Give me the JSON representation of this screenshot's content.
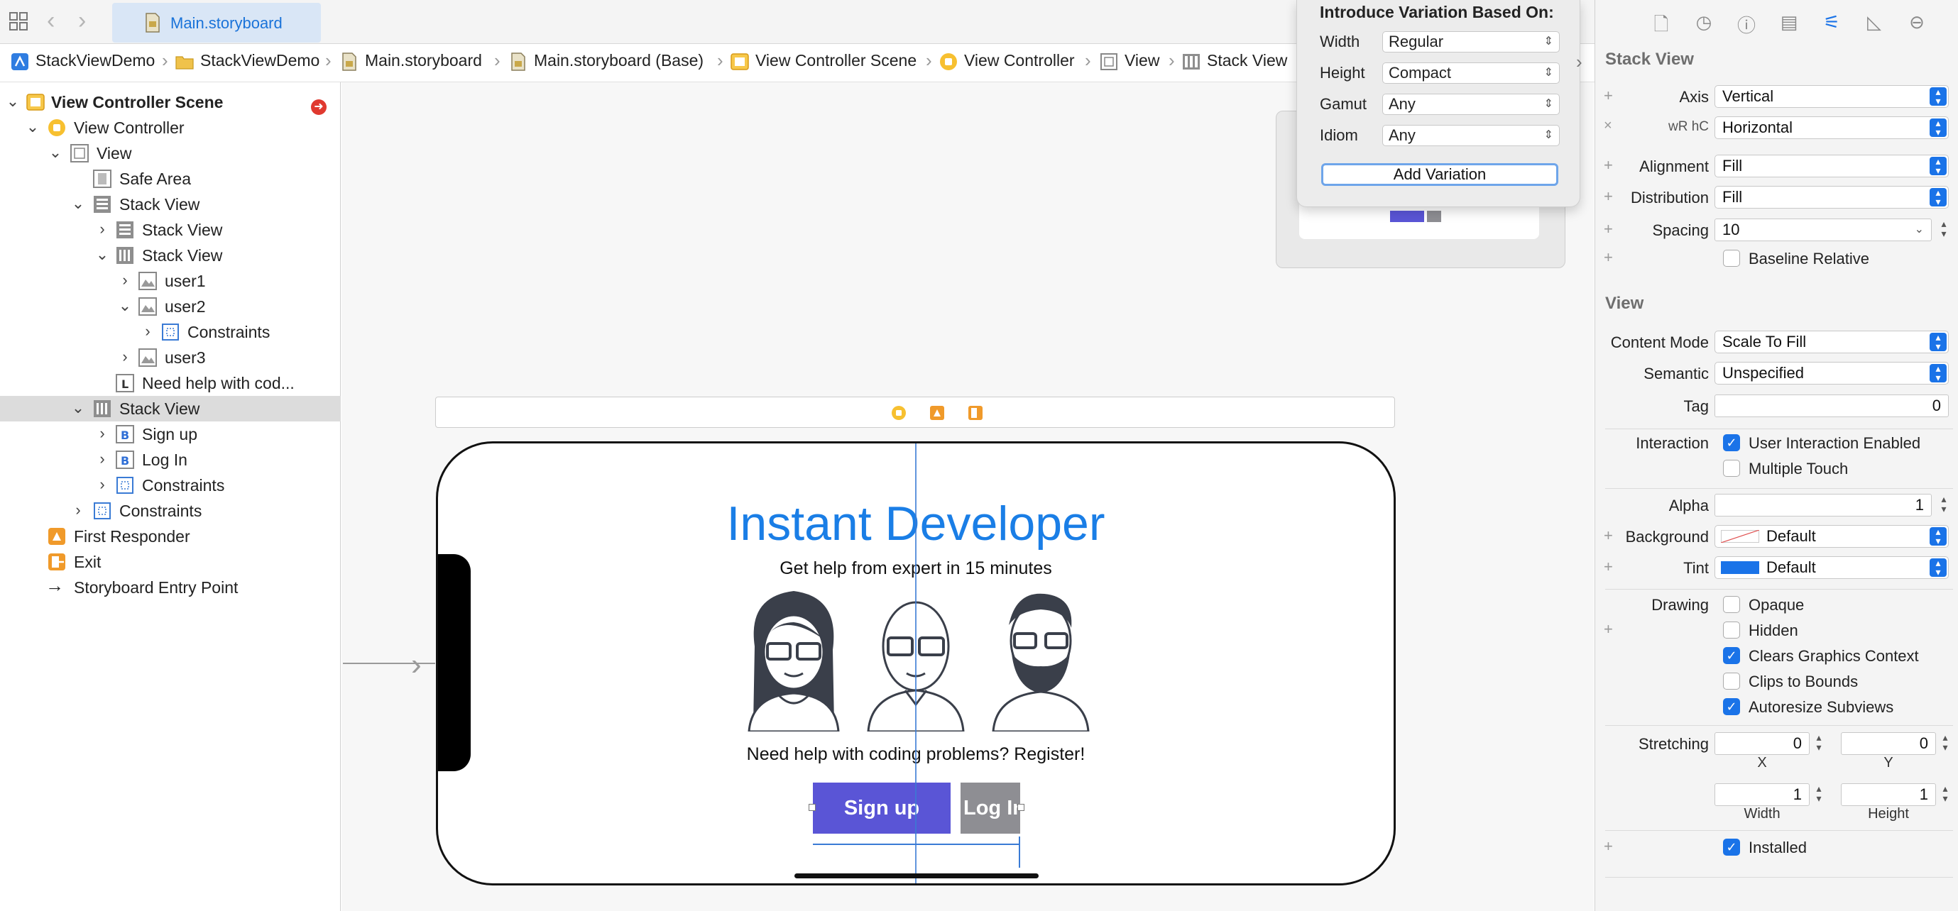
{
  "window": {
    "tab_title": "Main.storyboard"
  },
  "breadcrumb": [
    "StackViewDemo",
    "StackViewDemo",
    "Main.storyboard",
    "Main.storyboard (Base)",
    "View Controller Scene",
    "View Controller",
    "View",
    "Stack View"
  ],
  "navigator": {
    "items": [
      {
        "label": "View Controller Scene",
        "icon": "scene-icon"
      },
      {
        "label": "View Controller",
        "icon": "view-controller-icon"
      },
      {
        "label": "View",
        "icon": "view-icon"
      },
      {
        "label": "Safe Area",
        "icon": "safe-area-icon"
      },
      {
        "label": "Stack View",
        "icon": "vertical-stack-icon"
      },
      {
        "label": "Stack View",
        "icon": "vertical-stack-icon"
      },
      {
        "label": "Stack View",
        "icon": "horizontal-stack-icon"
      },
      {
        "label": "user1",
        "icon": "image-view-icon"
      },
      {
        "label": "user2",
        "icon": "image-view-icon"
      },
      {
        "label": "Constraints",
        "icon": "constraints-icon"
      },
      {
        "label": "user3",
        "icon": "image-view-icon"
      },
      {
        "label": "Need help with cod...",
        "icon": "label-icon"
      },
      {
        "label": "Stack View",
        "icon": "horizontal-stack-icon"
      },
      {
        "label": "Sign up",
        "icon": "button-icon"
      },
      {
        "label": "Log In",
        "icon": "button-icon"
      },
      {
        "label": "Constraints",
        "icon": "constraints-icon"
      },
      {
        "label": "Constraints",
        "icon": "constraints-icon"
      },
      {
        "label": "First Responder",
        "icon": "first-responder-icon"
      },
      {
        "label": "Exit",
        "icon": "exit-icon"
      },
      {
        "label": "Storyboard Entry Point",
        "icon": "arrow-right-icon"
      }
    ]
  },
  "canvas": {
    "title": "Instant Developer",
    "subtitle": "Get help from expert in 15 minutes",
    "prompt": "Need help with coding problems? Register!",
    "signup_label": "Sign up",
    "login_label": "Log In",
    "colors": {
      "title": "#1a7ee6",
      "signup_bg": "#5a55d6",
      "login_bg": "#8e8e93"
    }
  },
  "variation_popover": {
    "title": "Introduce Variation Based On:",
    "rows": [
      {
        "label": "Width",
        "value": "Regular"
      },
      {
        "label": "Height",
        "value": "Compact"
      },
      {
        "label": "Gamut",
        "value": "Any"
      },
      {
        "label": "Idiom",
        "value": "Any"
      }
    ],
    "button": "Add Variation"
  },
  "inspector": {
    "stack_view": {
      "title": "Stack View",
      "axis_label": "Axis",
      "axis_value": "Vertical",
      "variation_label": "wR hC",
      "variation_value": "Horizontal",
      "alignment_label": "Alignment",
      "alignment_value": "Fill",
      "distribution_label": "Distribution",
      "distribution_value": "Fill",
      "spacing_label": "Spacing",
      "spacing_value": "10",
      "baseline_label": "Baseline Relative"
    },
    "view": {
      "title": "View",
      "content_mode_label": "Content Mode",
      "content_mode_value": "Scale To Fill",
      "semantic_label": "Semantic",
      "semantic_value": "Unspecified",
      "tag_label": "Tag",
      "tag_value": "0",
      "interaction_label": "Interaction",
      "user_interaction": "User Interaction Enabled",
      "multiple_touch": "Multiple Touch",
      "alpha_label": "Alpha",
      "alpha_value": "1",
      "background_label": "Background",
      "background_value": "Default",
      "tint_label": "Tint",
      "tint_value": "Default",
      "tint_color": "#1a73e8",
      "drawing_label": "Drawing",
      "opaque": "Opaque",
      "hidden": "Hidden",
      "clears": "Clears Graphics Context",
      "clips": "Clips to Bounds",
      "autoresize": "Autoresize Subviews",
      "stretching_label": "Stretching",
      "stretch_x": "0",
      "stretch_y": "0",
      "stretch_w": "1",
      "stretch_h": "1",
      "x_label": "X",
      "y_label": "Y",
      "width_label": "Width",
      "height_label": "Height",
      "installed": "Installed"
    }
  }
}
